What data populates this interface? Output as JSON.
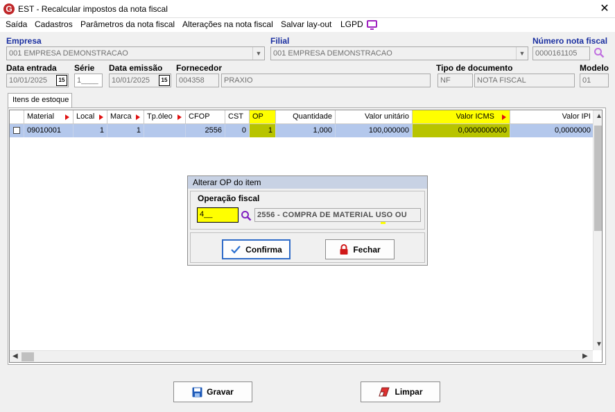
{
  "window": {
    "icon_letter": "G",
    "title": "EST - Recalcular impostos da nota fiscal",
    "close": "✕"
  },
  "menu": {
    "items": [
      "Saída",
      "Cadastros",
      "Parâmetros da nota fiscal",
      "Alterações na nota fiscal",
      "Salvar lay-out",
      "LGPD"
    ]
  },
  "header": {
    "empresa_label": "Empresa",
    "empresa_value": "001 EMPRESA DEMONSTRACAO",
    "filial_label": "Filial",
    "filial_value": "001 EMPRESA DEMONSTRACAO",
    "numero_label": "Número nota fiscal",
    "numero_value": "0000161105",
    "data_entrada_label": "Data entrada",
    "data_entrada_value": "10/01/2025",
    "serie_label": "Série",
    "serie_value": "1____",
    "data_emissao_label": "Data emissão",
    "data_emissao_value": "10/01/2025",
    "fornecedor_label": "Fornecedor",
    "fornecedor_code": "004358",
    "fornecedor_name": "PRAXIO",
    "tipo_doc_label": "Tipo de documento",
    "tipo_doc_code": "NF",
    "tipo_doc_name": "NOTA FISCAL",
    "modelo_label": "Modelo",
    "modelo_value": "01",
    "calendar_icon_text": "15"
  },
  "tabs": [
    {
      "label": "Itens de estoque"
    }
  ],
  "grid": {
    "columns": [
      "Material",
      "Local",
      "Marca",
      "Tp.óleo",
      "CFOP",
      "CST",
      "OP",
      "Quantidade",
      "Valor unitário",
      "Valor ICMS",
      "Valor IPI"
    ],
    "rows": [
      {
        "material": "09010001",
        "local": "1",
        "marca": "1",
        "tp_oleo": "",
        "cfop": "2556",
        "cst": "0",
        "op": "1",
        "quantidade": "1,000",
        "valor_unitario": "100,000000",
        "valor_icms": "0,0000000000",
        "valor_ipi": "0,0000000"
      }
    ],
    "highlight_color": "#ffff00"
  },
  "dialog": {
    "title": "Alterar OP do item",
    "field_label": "Operação fiscal",
    "op_value": "4__",
    "op_description": "2556 - COMPRA DE MATERIAL USO OU",
    "confirm_label": "Confirma",
    "close_label": "Fechar"
  },
  "footer": {
    "save_label": "Gravar",
    "clear_label": "Limpar"
  },
  "colors": {
    "accent": "#1a2fa0",
    "selection": "#b4c8ec",
    "highlight": "#ffff00"
  }
}
